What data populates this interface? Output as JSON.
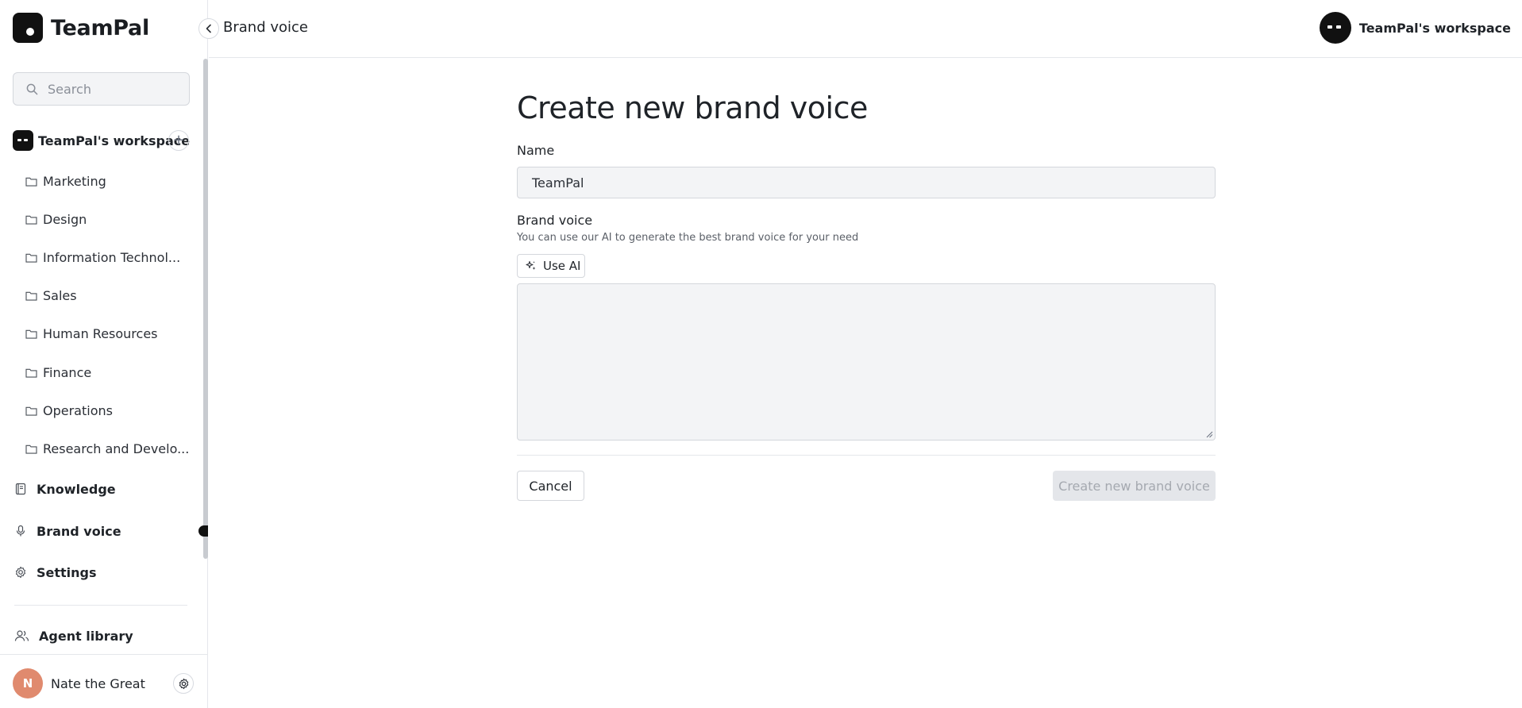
{
  "app": {
    "name": "TeamPal"
  },
  "header": {
    "title": "Brand voice",
    "workspace_label": "TeamPal's workspace"
  },
  "sidebar": {
    "search_placeholder": "Search",
    "workspace": {
      "name": "TeamPal's workspace"
    },
    "folders": [
      {
        "label": "Marketing"
      },
      {
        "label": "Design"
      },
      {
        "label": "Information Technol..."
      },
      {
        "label": "Sales"
      },
      {
        "label": "Human Resources"
      },
      {
        "label": "Finance"
      },
      {
        "label": "Operations"
      },
      {
        "label": "Research and Develo..."
      }
    ],
    "nav": [
      {
        "label": "Knowledge",
        "icon": "book-icon"
      },
      {
        "label": "Brand voice",
        "icon": "microphone-icon",
        "active": true
      },
      {
        "label": "Settings",
        "icon": "gear-icon"
      },
      {
        "label": "Agent library",
        "icon": "users-icon"
      }
    ],
    "user": {
      "initial": "N",
      "name": "Nate the Great",
      "avatar_color": "#e08a6e"
    }
  },
  "form": {
    "heading": "Create new brand voice",
    "name_label": "Name",
    "name_value": "TeamPal",
    "brand_voice_label": "Brand voice",
    "brand_voice_hint": "You can use our AI to generate the best brand voice for your need",
    "use_ai_label": "Use AI",
    "brand_voice_value": "",
    "cancel_label": "Cancel",
    "submit_label": "Create new brand voice"
  }
}
